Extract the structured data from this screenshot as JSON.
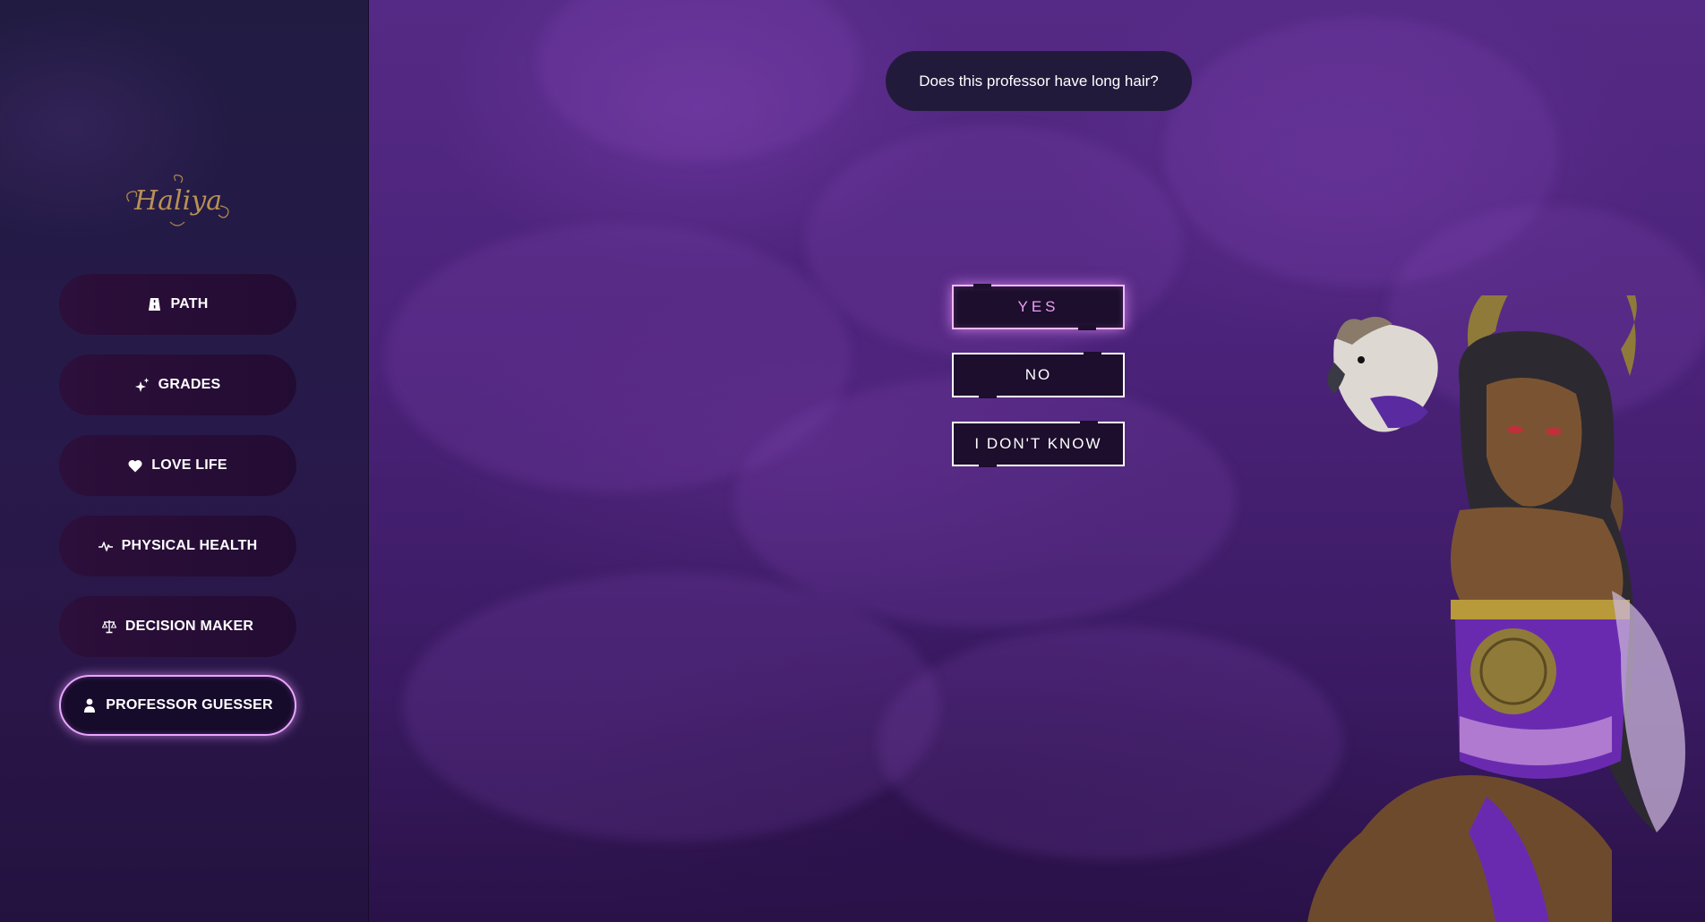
{
  "sidebar": {
    "logo_text": "Haliya",
    "items": [
      {
        "label": "PATH",
        "icon": "road-icon",
        "active": false
      },
      {
        "label": "GRADES",
        "icon": "sparkles-icon",
        "active": false
      },
      {
        "label": "LOVE LIFE",
        "icon": "heart-icon",
        "active": false
      },
      {
        "label": "PHYSICAL HEALTH",
        "icon": "heartbeat-icon",
        "active": false
      },
      {
        "label": "DECISION MAKER",
        "icon": "scale-icon",
        "active": false
      },
      {
        "label": "PROFESSOR GUESSER",
        "icon": "person-icon",
        "active": true
      }
    ]
  },
  "main": {
    "question": "Does this professor have long hair?",
    "answers": [
      {
        "label": "YES",
        "selected": true
      },
      {
        "label": "NO",
        "selected": false
      },
      {
        "label": "I DON'T KNOW",
        "selected": false
      }
    ]
  },
  "colors": {
    "accent": "#e9a6ff",
    "sidebar_bg": "#231a42",
    "main_bg": "#4a2278",
    "button_bg": "#1c0e2c"
  }
}
